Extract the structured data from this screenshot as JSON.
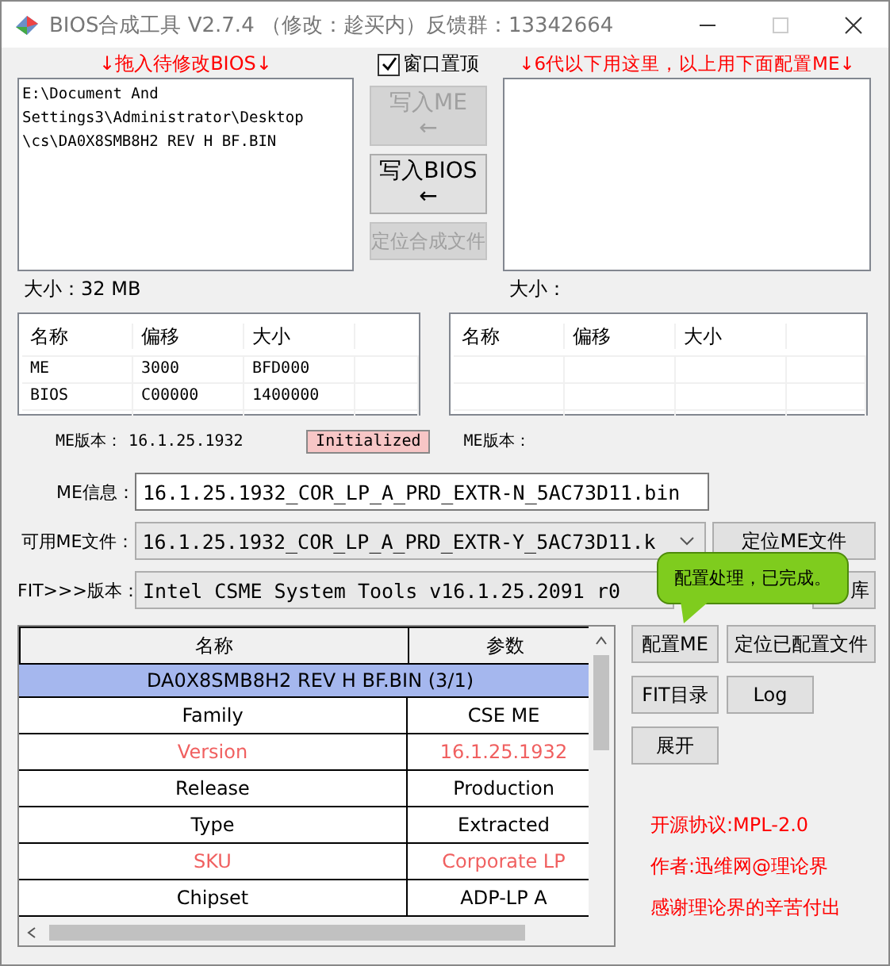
{
  "window": {
    "title": "BIOS合成工具 V2.7.4 （修改：趁买内）反馈群：13342664"
  },
  "left_panel": {
    "hint": "↓拖入待修改BIOS↓",
    "file_path": "E:\\Document And\nSettings3\\Administrator\\Desktop\n\\cs\\DA0X8SMB8H2 REV H BF.BIN",
    "size_label": "大小：32 MB"
  },
  "middle": {
    "checkbox": {
      "label": "窗口置顶",
      "checked": true
    },
    "buttons": [
      {
        "label": "写入ME",
        "arrow": "←",
        "disabled": true
      },
      {
        "label": "写入BIOS",
        "arrow": "←",
        "disabled": false
      },
      {
        "label": "定位合成文件",
        "disabled": true
      }
    ]
  },
  "right_panel": {
    "hint": "↓6代以下用这里，以上用下面配置ME↓",
    "size_label": "大小："
  },
  "region_tables": [
    {
      "columns": [
        "名称",
        "偏移",
        "大小"
      ],
      "rows": [
        [
          "ME",
          "3000",
          "BFD000"
        ],
        [
          "BIOS",
          "C00000",
          "1400000"
        ]
      ]
    },
    {
      "columns": [
        "名称",
        "偏移",
        "大小"
      ]
    }
  ],
  "me_version_left": {
    "label": "ME版本：",
    "value": "16.1.25.1932"
  },
  "status_badge": "Initialized",
  "me_version_right": {
    "label": "ME版本："
  },
  "me_info": {
    "label": "ME信息：",
    "value": "16.1.25.1932_COR_LP_A_PRD_EXTR-N_5AC73D11.bin"
  },
  "me_file": {
    "label": "可用ME文件：",
    "value": "16.1.25.1932_COR_LP_A_PRD_EXTR-Y_5AC73D11.k",
    "button": "定位ME文件"
  },
  "fit": {
    "label": "FIT>>>版本：",
    "value": "Intel CSME System Tools v16.1.25.2091 r0",
    "button": "库"
  },
  "tooltip": "配置处理，已完成。",
  "grid": {
    "columns": [
      "名称",
      "参数"
    ],
    "group": "DA0X8SMB8H2 REV H BF.BIN (3/1)",
    "rows": [
      {
        "name": "Family",
        "value": "CSE ME",
        "highlight": false
      },
      {
        "name": "Version",
        "value": "16.1.25.1932",
        "highlight": true
      },
      {
        "name": "Release",
        "value": "Production",
        "highlight": false
      },
      {
        "name": "Type",
        "value": "Extracted",
        "highlight": false
      },
      {
        "name": "SKU",
        "value": "Corporate LP",
        "highlight": true
      },
      {
        "name": "Chipset",
        "value": "ADP-LP A",
        "highlight": false
      }
    ]
  },
  "actions": [
    [
      "配置ME",
      "定位已配置文件"
    ],
    [
      "FIT目录",
      "Log"
    ],
    [
      "展开"
    ]
  ],
  "credits": [
    "开源协议:MPL-2.0",
    "作者:迅维网@理论界",
    "感谢理论界的辛苦付出"
  ]
}
